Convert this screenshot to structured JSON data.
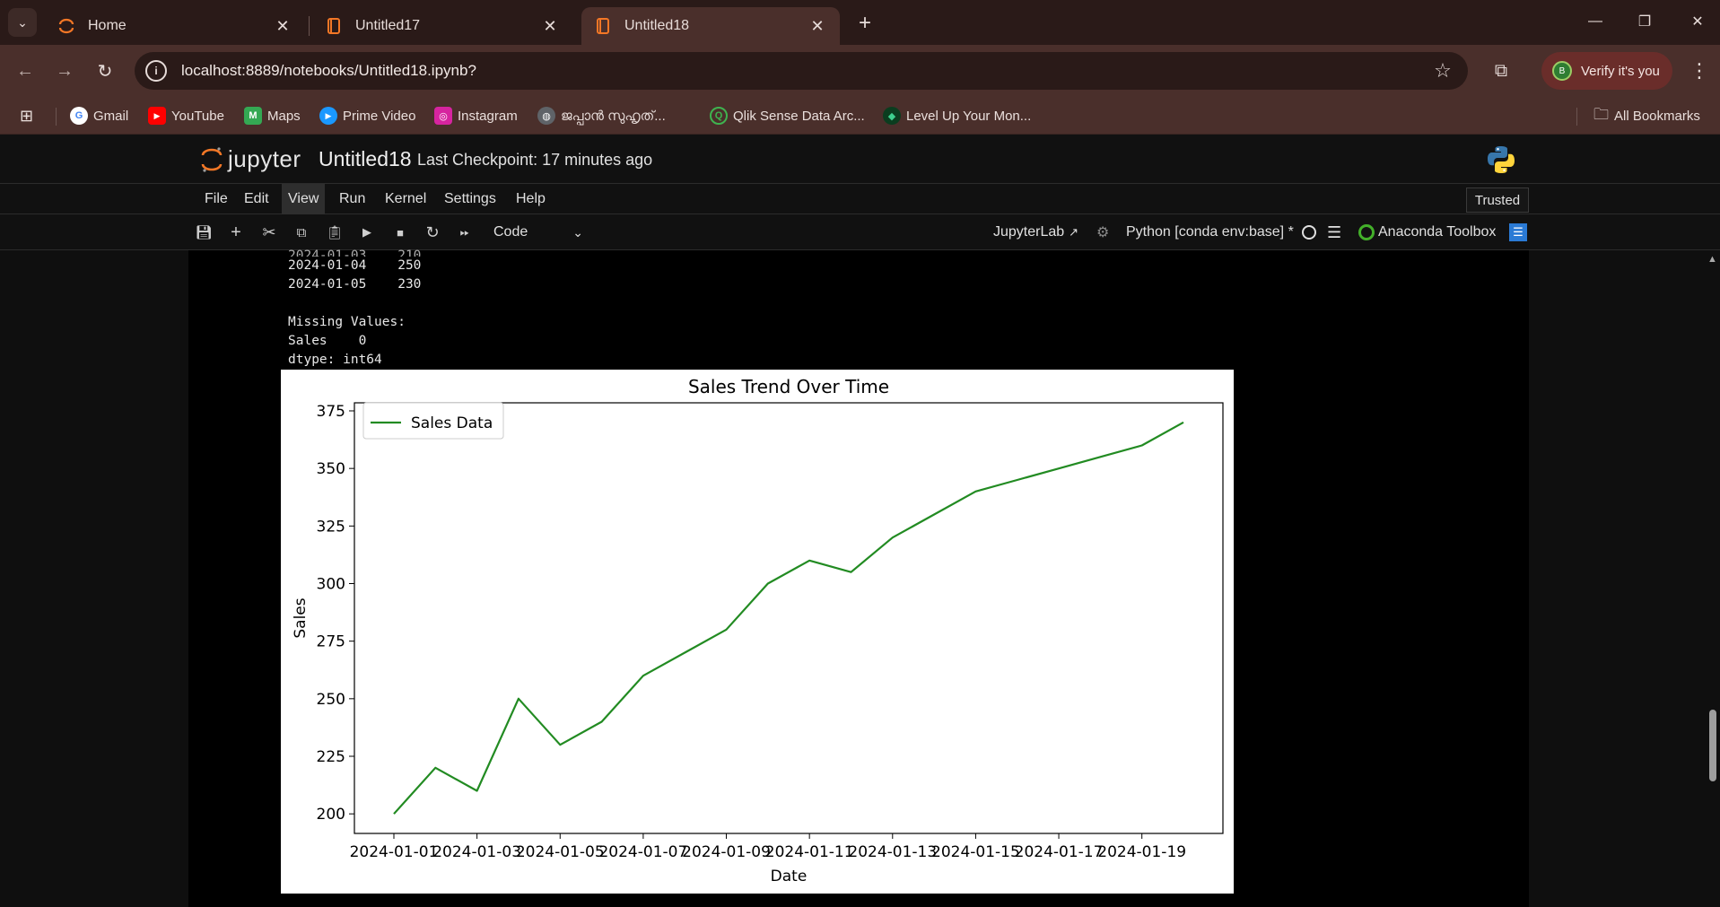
{
  "browser": {
    "tabs": [
      {
        "title": "Home",
        "active": false
      },
      {
        "title": "Untitled17",
        "active": false
      },
      {
        "title": "Untitled18",
        "active": true
      }
    ],
    "url": "localhost:8889/notebooks/Untitled18.ipynb?",
    "profile_label": "Verify it's you",
    "profile_initial": "B",
    "bookmarks": [
      {
        "label": "Gmail",
        "icon": "G"
      },
      {
        "label": "YouTube",
        "icon": "▶"
      },
      {
        "label": "Maps",
        "icon": "M"
      },
      {
        "label": "Prime Video",
        "icon": "▶"
      },
      {
        "label": "Instagram",
        "icon": "◎"
      },
      {
        "label": "ജപ്പാൻ സുഹൃത്...",
        "icon": "◍"
      },
      {
        "label": "Qlik Sense Data Arc...",
        "icon": "Q"
      },
      {
        "label": "Level Up Your Mon...",
        "icon": "◆"
      }
    ],
    "all_bookmarks": "All Bookmarks"
  },
  "jupyter": {
    "logo_text": "jupyter",
    "notebook_name": "Untitled18",
    "checkpoint": "Last Checkpoint: 17 minutes ago",
    "menu": [
      "File",
      "Edit",
      "View",
      "Run",
      "Kernel",
      "Settings",
      "Help"
    ],
    "trusted": "Trusted",
    "cell_type": "Code",
    "jupyterlab_link": "JupyterLab",
    "kernel_name": "Python [conda env:base] *",
    "anaconda_toolbox": "Anaconda Toolbox"
  },
  "output": {
    "lines": [
      "2024-01-04    250",
      "2024-01-05    230",
      "",
      "Missing Values:",
      "Sales    0",
      "dtype: int64"
    ]
  },
  "chart_data": {
    "type": "line",
    "title": "Sales Trend Over Time",
    "xlabel": "Date",
    "ylabel": "Sales",
    "x": [
      "2024-01-01",
      "2024-01-02",
      "2024-01-03",
      "2024-01-04",
      "2024-01-05",
      "2024-01-06",
      "2024-01-07",
      "2024-01-08",
      "2024-01-09",
      "2024-01-10",
      "2024-01-11",
      "2024-01-12",
      "2024-01-13",
      "2024-01-14",
      "2024-01-15",
      "2024-01-16",
      "2024-01-17",
      "2024-01-18",
      "2024-01-19",
      "2024-01-20"
    ],
    "series": [
      {
        "name": "Sales Data",
        "color": "#228b22",
        "values": [
          200,
          220,
          210,
          250,
          230,
          240,
          260,
          270,
          280,
          300,
          310,
          305,
          320,
          330,
          340,
          345,
          350,
          355,
          360,
          370
        ]
      }
    ],
    "x_tick_labels": [
      "2024-01-01",
      "2024-01-03",
      "2024-01-05",
      "2024-01-07",
      "2024-01-09",
      "2024-01-11",
      "2024-01-13",
      "2024-01-15",
      "2024-01-17",
      "2024-01-19"
    ],
    "y_ticks": [
      200,
      225,
      250,
      275,
      300,
      325,
      350,
      375
    ],
    "ylim": [
      191.5,
      378.5
    ],
    "legend": "upper-left",
    "grid": false
  }
}
